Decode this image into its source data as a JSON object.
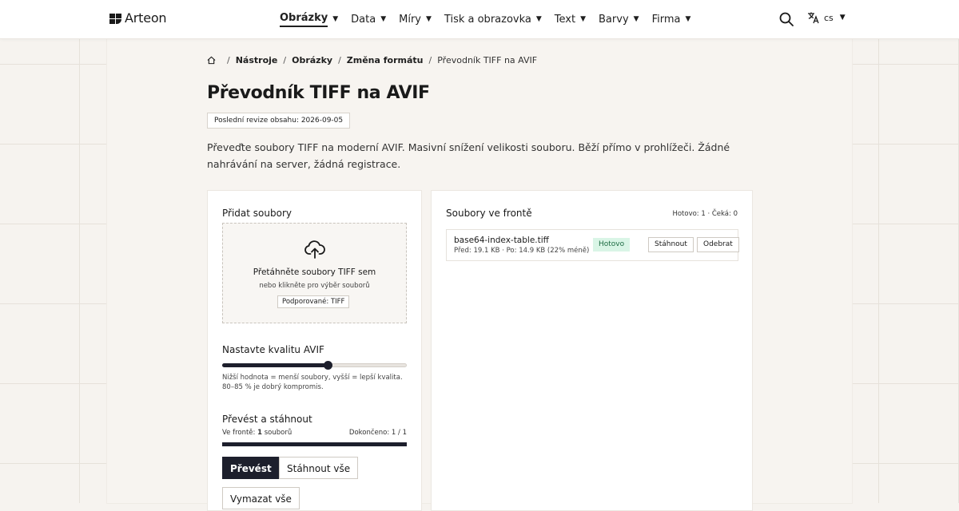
{
  "header": {
    "logo_text": "Arteon",
    "nav": [
      {
        "label": "Obrázky",
        "active": true
      },
      {
        "label": "Data"
      },
      {
        "label": "Míry"
      },
      {
        "label": "Tisk a obrazovka"
      },
      {
        "label": "Text"
      },
      {
        "label": "Barvy"
      },
      {
        "label": "Firma"
      }
    ],
    "language": "cs"
  },
  "breadcrumb": {
    "items": [
      "Nástroje",
      "Obrázky",
      "Změna formátu"
    ],
    "current": "Převodník TIFF na AVIF"
  },
  "page": {
    "title": "Převodník TIFF na AVIF",
    "revision": "Poslední revize obsahu: 2026-09-05",
    "intro": "Převeďte soubory TIFF na moderní AVIF. Masivní snížení velikosti souboru. Běží přímo v prohlížeči. Žádné nahrávání na server, žádná registrace."
  },
  "add_files": {
    "title": "Přidat soubory",
    "drop_title": "Přetáhněte soubory TIFF sem",
    "drop_sub": "nebo klikněte pro výběr souborů",
    "supported": "Podporované: TIFF"
  },
  "quality": {
    "title": "Nastavte kvalitu AVIF",
    "value": 0.57,
    "hint": "Nižší hodnota = menší soubory, vyšší = lepší kvalita. 80–85 % je dobrý kompromis."
  },
  "convert": {
    "title": "Převést a stáhnout",
    "queue_prefix": "Ve frontě: ",
    "queue_count": "1",
    "queue_suffix": " souborů",
    "done_text": "Dokončeno: 1 / 1",
    "progress": 1.0,
    "convert_label": "Převést",
    "download_all_label": "Stáhnout vše",
    "clear_all_label": "Vymazat vše"
  },
  "queue": {
    "title": "Soubory ve frontě",
    "stats": "Hotovo: 1 · Čeká: 0",
    "files": [
      {
        "name": "base64-index-table.tiff",
        "meta": "Před: 19.1 KB · Po: 14.9 KB (22% méně)",
        "status": "Hotovo",
        "download_label": "Stáhnout",
        "remove_label": "Odebrat"
      }
    ]
  }
}
